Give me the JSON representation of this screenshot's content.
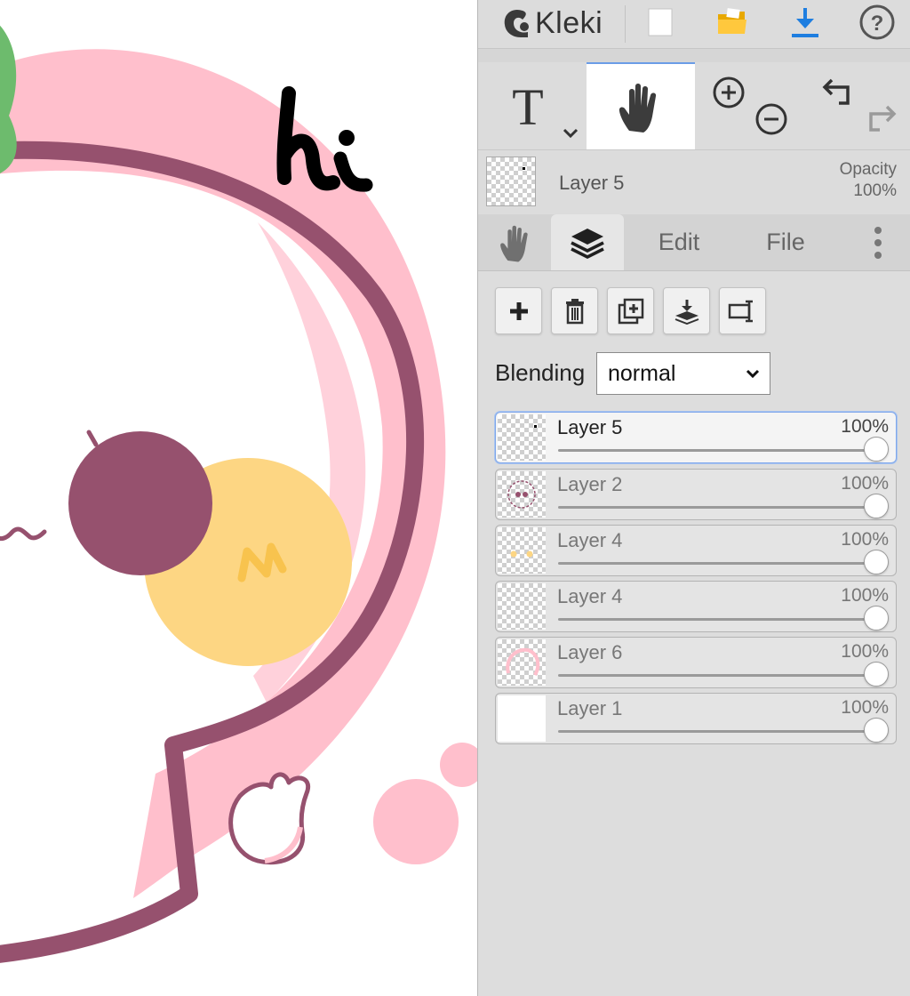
{
  "app": {
    "name": "Kleki"
  },
  "top_toolbar": {
    "buttons": [
      {
        "name": "new-image",
        "icon": "blank-page-icon"
      },
      {
        "name": "open",
        "icon": "folder-icon"
      },
      {
        "name": "save",
        "icon": "download-icon"
      },
      {
        "name": "help",
        "icon": "help-icon"
      }
    ]
  },
  "tools": {
    "items": [
      {
        "name": "text",
        "icon": "text-tool-icon",
        "has_dropdown": true
      },
      {
        "name": "hand",
        "icon": "hand-icon",
        "active": true
      },
      {
        "name": "zoom",
        "icon": "zoom-in-out-icon"
      },
      {
        "name": "undo-redo",
        "icon": "undo-redo-icon"
      }
    ]
  },
  "current_layer": {
    "name": "Layer 5",
    "opacity_label": "Opacity",
    "opacity_value": "100%"
  },
  "tabs": [
    {
      "icon": "hand-icon"
    },
    {
      "icon": "layers-icon",
      "active": true
    },
    {
      "label": "Edit"
    },
    {
      "label": "File"
    },
    {
      "icon": "more-vertical-icon"
    }
  ],
  "layer_actions": [
    {
      "icon": "add-layer-icon"
    },
    {
      "icon": "trash-icon"
    },
    {
      "icon": "duplicate-icon"
    },
    {
      "icon": "merge-down-icon"
    },
    {
      "icon": "rename-icon"
    }
  ],
  "blending": {
    "label": "Blending",
    "value": "normal"
  },
  "layers": [
    {
      "name": "Layer 5",
      "opacity": "100%",
      "active": true
    },
    {
      "name": "Layer 2",
      "opacity": "100%"
    },
    {
      "name": "Layer 4",
      "opacity": "100%"
    },
    {
      "name": "Layer 4",
      "opacity": "100%"
    },
    {
      "name": "Layer 6",
      "opacity": "100%"
    },
    {
      "name": "Layer 1",
      "opacity": "100%"
    }
  ],
  "canvas": {
    "handwriting": "hi",
    "sketch_mark": "n"
  },
  "colors": {
    "pink": "#ffbfcc",
    "plum": "#96516e",
    "yellow": "#fdd683",
    "green": "#6dbb6d",
    "accent": "#1e7ee0"
  }
}
